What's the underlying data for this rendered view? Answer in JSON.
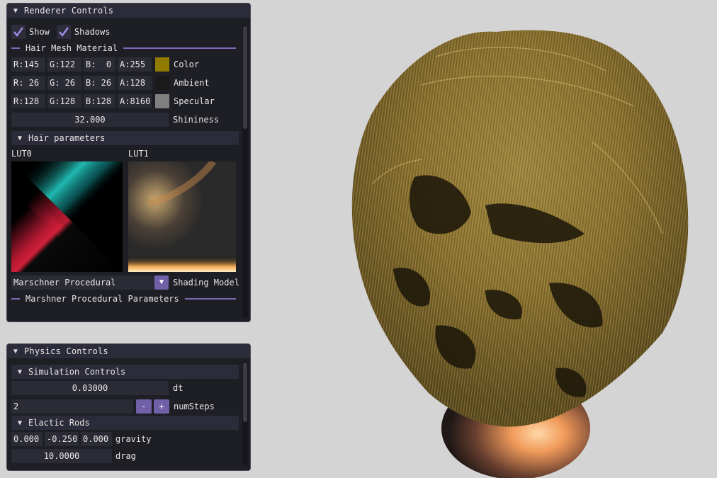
{
  "renderer": {
    "title": "Renderer Controls",
    "show_label": "Show",
    "shadows_label": "Shadows",
    "material_header": "Hair Mesh Material",
    "color_rows": [
      {
        "r": "R:145",
        "g": "G:122",
        "b": "B:  0",
        "a": "A:255",
        "swatch": "#917a00",
        "label": "Color"
      },
      {
        "r": "R: 26",
        "g": "G: 26",
        "b": "B: 26",
        "a": "A:128",
        "swatch": "#1a1a1a",
        "label": "Ambient"
      },
      {
        "r": "R:128",
        "g": "G:128",
        "b": "B:128",
        "a": "A:8160",
        "swatch": "#808080",
        "label": "Specular"
      }
    ],
    "shininess_value": "32.000",
    "shininess_label": "Shininess",
    "hair_params_header": "Hair parameters",
    "lut0_label": "LUT0",
    "lut1_label": "LUT1",
    "shading_model_value": "Marschner Procedural",
    "shading_model_label": "Shading Model",
    "procedural_params_header": "Marshner Procedural Parameters"
  },
  "physics": {
    "title": "Physics Controls",
    "sim_header": "Simulation Controls",
    "dt_value": "0.03000",
    "dt_label": "dt",
    "numsteps_value": "2",
    "minus_label": "-",
    "plus_label": "+",
    "numsteps_label": "numSteps",
    "rods_header": "Elactic Rods",
    "gravity_x": "0.000",
    "gravity_y": "-0.250",
    "gravity_z": "0.000",
    "gravity_label": "gravity",
    "drag_value": "10.0000",
    "drag_label": "drag"
  },
  "colors": {
    "accent": "#8067b3",
    "checkmark": "#a38be6",
    "panel_bg": "#1e1e25",
    "viewport_bg": "#d4d4d4",
    "hair": "#8a7230"
  }
}
